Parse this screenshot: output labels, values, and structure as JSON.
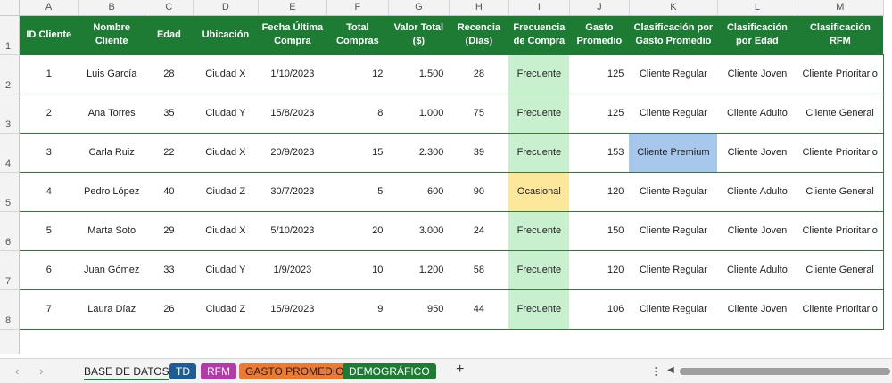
{
  "columns": [
    "A",
    "B",
    "C",
    "D",
    "E",
    "F",
    "G",
    "H",
    "I",
    "J",
    "K",
    "L",
    "M"
  ],
  "row_numbers": [
    "1",
    "2",
    "3",
    "4",
    "5",
    "6",
    "7",
    "8"
  ],
  "headers": {
    "id": "ID Cliente",
    "nombre": "Nombre Cliente",
    "edad": "Edad",
    "ubicacion": "Ubicación",
    "fecha": "Fecha Última Compra",
    "total_compras": "Total Compras",
    "valor_total": "Valor Total ($)",
    "recencia": "Recencia (Días)",
    "frecuencia": "Frecuencia de Compra",
    "gasto": "Gasto Promedio",
    "clas_gasto": "Clasificación por Gasto Promedio",
    "clas_edad": "Clasificación por Edad",
    "clas_rfm": "Clasificación RFM"
  },
  "rows": [
    {
      "id": "1",
      "nombre": "Luis García",
      "edad": "28",
      "ubicacion": "Ciudad X",
      "fecha": "1/10/2023",
      "total_compras": "12",
      "valor_total": "1.500",
      "recencia": "28",
      "frecuencia": "Frecuente",
      "gasto": "125",
      "clas_gasto": "Cliente Regular",
      "clas_edad": "Cliente Joven",
      "clas_rfm": "Cliente Prioritario"
    },
    {
      "id": "2",
      "nombre": "Ana Torres",
      "edad": "35",
      "ubicacion": "Ciudad Y",
      "fecha": "15/8/2023",
      "total_compras": "8",
      "valor_total": "1.000",
      "recencia": "75",
      "frecuencia": "Frecuente",
      "gasto": "125",
      "clas_gasto": "Cliente Regular",
      "clas_edad": "Cliente Adulto",
      "clas_rfm": "Cliente General"
    },
    {
      "id": "3",
      "nombre": "Carla Ruiz",
      "edad": "22",
      "ubicacion": "Ciudad X",
      "fecha": "20/9/2023",
      "total_compras": "15",
      "valor_total": "2.300",
      "recencia": "39",
      "frecuencia": "Frecuente",
      "gasto": "153",
      "clas_gasto": "Cliente Premium",
      "clas_edad": "Cliente Joven",
      "clas_rfm": "Cliente Prioritario"
    },
    {
      "id": "4",
      "nombre": "Pedro López",
      "edad": "40",
      "ubicacion": "Ciudad Z",
      "fecha": "30/7/2023",
      "total_compras": "5",
      "valor_total": "600",
      "recencia": "90",
      "frecuencia": "Ocasional",
      "gasto": "120",
      "clas_gasto": "Cliente Regular",
      "clas_edad": "Cliente Adulto",
      "clas_rfm": "Cliente General"
    },
    {
      "id": "5",
      "nombre": "Marta Soto",
      "edad": "29",
      "ubicacion": "Ciudad X",
      "fecha": "5/10/2023",
      "total_compras": "20",
      "valor_total": "3.000",
      "recencia": "24",
      "frecuencia": "Frecuente",
      "gasto": "150",
      "clas_gasto": "Cliente Regular",
      "clas_edad": "Cliente Joven",
      "clas_rfm": "Cliente Prioritario"
    },
    {
      "id": "6",
      "nombre": "Juan Gómez",
      "edad": "33",
      "ubicacion": "Ciudad Y",
      "fecha": "1/9/2023",
      "total_compras": "10",
      "valor_total": "1.200",
      "recencia": "58",
      "frecuencia": "Frecuente",
      "gasto": "120",
      "clas_gasto": "Cliente Regular",
      "clas_edad": "Cliente Adulto",
      "clas_rfm": "Cliente General"
    },
    {
      "id": "7",
      "nombre": "Laura Díaz",
      "edad": "26",
      "ubicacion": "Ciudad Z",
      "fecha": "15/9/2023",
      "total_compras": "9",
      "valor_total": "950",
      "recencia": "44",
      "frecuencia": "Frecuente",
      "gasto": "106",
      "clas_gasto": "Cliente Regular",
      "clas_edad": "Cliente Joven",
      "clas_rfm": "Cliente Prioritario"
    }
  ],
  "tabs": {
    "base": "BASE DE DATOS",
    "td": "TD",
    "rfm": "RFM",
    "gasto": "GASTO PROMEDIO",
    "demo": "DEMOGRÁFICO",
    "add": "+"
  },
  "nav": {
    "prev": "‹",
    "next": "›",
    "scroll_left": "◀"
  },
  "colors": {
    "header_green": "#1e7b34",
    "frecuente_bg": "#c8efce",
    "ocasional_bg": "#fde79a",
    "premium_bg": "#a7c8ec",
    "tab_td": "#1f5c96",
    "tab_rfm": "#b33aa8",
    "tab_gasto": "#ee7a32",
    "tab_demo": "#1e7b34"
  }
}
